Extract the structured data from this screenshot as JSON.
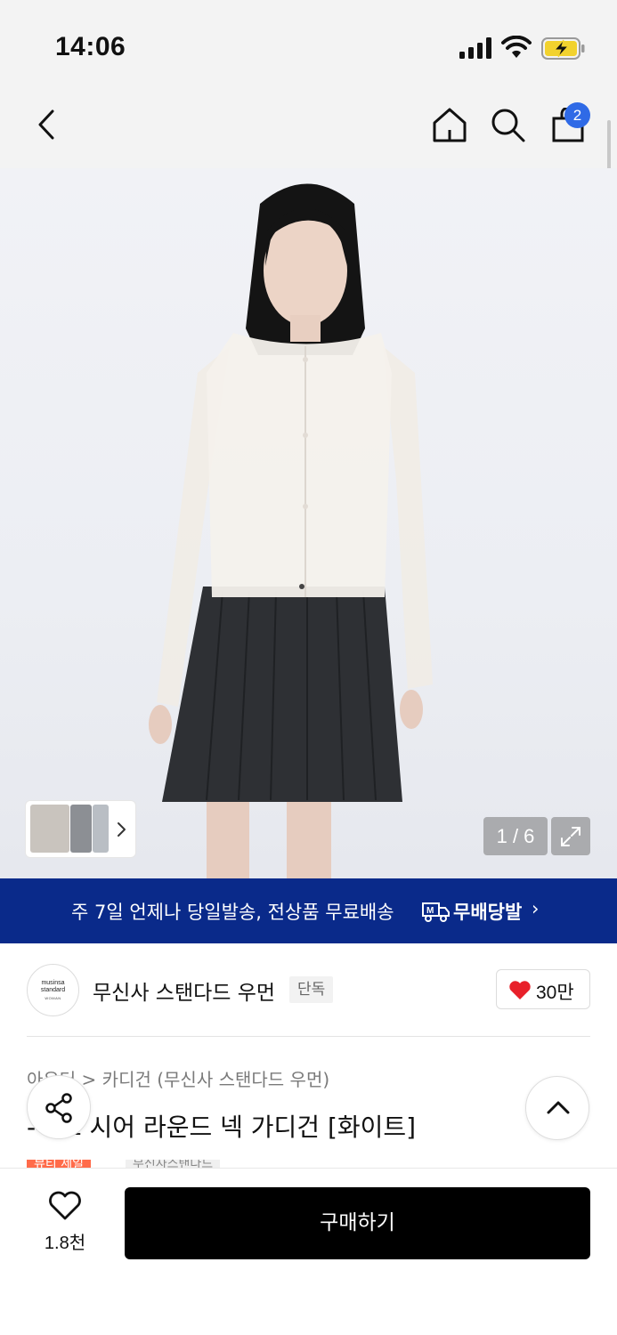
{
  "status_bar": {
    "time": "14:06",
    "icons": [
      "cellular-signal-icon",
      "wifi-icon",
      "battery-charging-icon"
    ]
  },
  "nav": {
    "icons": [
      "back-chevron-icon",
      "home-icon",
      "search-icon",
      "shopping-bag-icon"
    ],
    "cart_count": "2"
  },
  "hero": {
    "counter": "1 / 6",
    "icons": [
      "expand-icon",
      "chevron-right-icon"
    ]
  },
  "promo": {
    "text": "주 7일 언제나 당일발송, 전상품 무료배송",
    "logo_text": "무배당발",
    "chevron": "›"
  },
  "brand": {
    "logo_line1": "musinsa",
    "logo_line2": "standard",
    "logo_line3": "WOMAN",
    "name": "무신사 스탠다드 우먼",
    "badge": "단독",
    "like_count": "30만"
  },
  "product": {
    "breadcrumb": "아우터 > 카디건 (무신사 스탠다드 우먼)",
    "title": "-이즈 시어 라운드 넥 가디건 [화이트]",
    "tags": [
      "뷰티 세일",
      "무신사스탠다드"
    ]
  },
  "bottom_bar": {
    "wish_count": "1.8천",
    "buy_label": "구매하기"
  },
  "colors": {
    "promo_bg": "#0a2a8a",
    "badge_blue": "#2f6ae6",
    "heart_red": "#e8202a",
    "buy_bg": "#000000",
    "sale_tag": "#ff6b4a"
  }
}
